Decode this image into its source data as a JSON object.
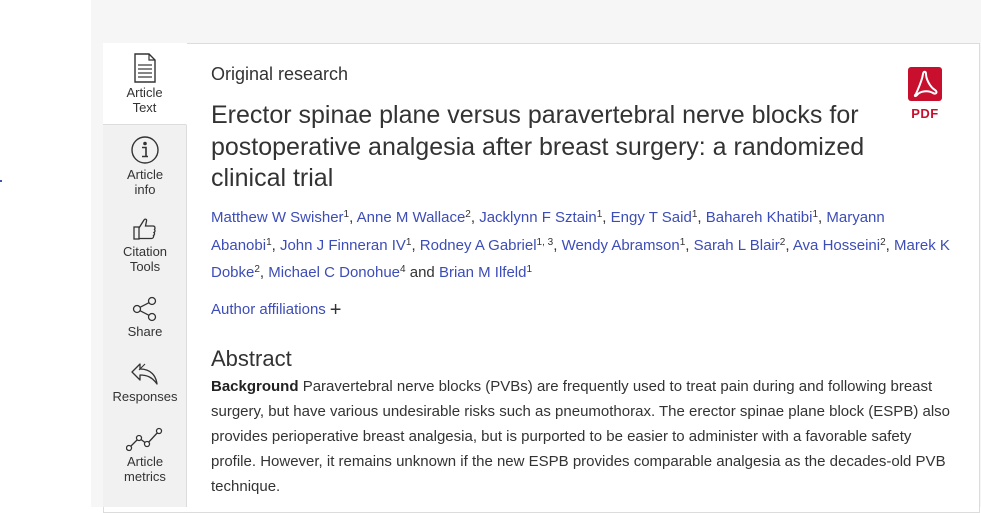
{
  "sidebar": {
    "items": [
      {
        "label_line1": "Article",
        "label_line2": "Text",
        "icon": "document-icon"
      },
      {
        "label_line1": "Article",
        "label_line2": "info",
        "icon": "info-icon"
      },
      {
        "label_line1": "Citation",
        "label_line2": "Tools",
        "icon": "thumbs-up-icon"
      },
      {
        "label_line1": "Share",
        "label_line2": "",
        "icon": "share-icon"
      },
      {
        "label_line1": "Responses",
        "label_line2": "",
        "icon": "reply-icon"
      },
      {
        "label_line1": "Article",
        "label_line2": "metrics",
        "icon": "metrics-icon"
      }
    ]
  },
  "article": {
    "kicker": "Original research",
    "title": "Erector spinae plane versus paravertebral nerve blocks for postoperative analgesia after breast surgery: a randomized clinical trial",
    "pdf_label": "PDF",
    "authors": [
      {
        "name": "Matthew W Swisher",
        "sup": "1"
      },
      {
        "name": "Anne M Wallace",
        "sup": "2"
      },
      {
        "name": "Jacklynn F Sztain",
        "sup": "1"
      },
      {
        "name": "Engy T Said",
        "sup": "1"
      },
      {
        "name": "Bahareh Khatibi",
        "sup": "1"
      },
      {
        "name": "Maryann Abanobi",
        "sup": "1"
      },
      {
        "name": "John J Finneran IV",
        "sup": "1"
      },
      {
        "name": "Rodney A Gabriel",
        "sup": "1, 3"
      },
      {
        "name": "Wendy Abramson",
        "sup": "1"
      },
      {
        "name": "Sarah L Blair",
        "sup": "2"
      },
      {
        "name": "Ava Hosseini",
        "sup": "2"
      },
      {
        "name": "Marek K Dobke",
        "sup": "2"
      },
      {
        "name": "Michael C Donohue",
        "sup": "4"
      },
      {
        "name": "Brian M Ilfeld",
        "sup": "1"
      }
    ],
    "authors_and": "and",
    "affiliations_label": "Author affiliations",
    "affiliations_toggle": "+",
    "abstract_heading": "Abstract",
    "abstract_background_label": "Background",
    "abstract_background_text": "Paravertebral nerve blocks (PVBs) are frequently used to treat pain during and following breast surgery, but have various undesirable risks such as pneumothorax. The erector spinae plane block (ESPB) also provides perioperative breast analgesia, but is purported to be easier to administer with a favorable safety profile. However, it remains unknown if the new ESPB provides comparable analgesia as the decades-old PVB technique."
  },
  "colors": {
    "link": "#3d4db7",
    "pdf_red": "#c8102e",
    "sidebar_bg": "#f1f1f1"
  }
}
